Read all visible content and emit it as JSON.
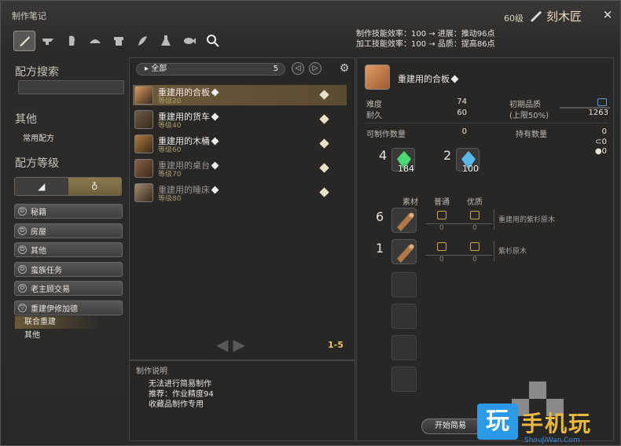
{
  "header": {
    "title": "制作笔记",
    "level": "60级",
    "job": "刻木匠",
    "close_glyph": "✕"
  },
  "tabs": [
    {
      "icon": "saw-icon",
      "active": true
    },
    {
      "icon": "anvil-icon",
      "active": false
    },
    {
      "icon": "gauntlet-icon",
      "active": false
    },
    {
      "icon": "helmet-icon",
      "active": false
    },
    {
      "icon": "armor-icon",
      "active": false
    },
    {
      "icon": "feather-icon",
      "active": false
    },
    {
      "icon": "flask-icon",
      "active": false
    },
    {
      "icon": "fish-icon",
      "active": false
    },
    {
      "icon": "search-icon",
      "active": false
    }
  ],
  "efficiency": {
    "line1": "制作技能效率：100 → 进展：推动96点",
    "line2": "加工技能效率：100 → 品质：提高86点"
  },
  "left": {
    "recipe_search": "配方搜索",
    "other_title": "其他",
    "common_recipes": "常用配方",
    "recipe_level": "配方等级",
    "categories": [
      {
        "label": "秘籍",
        "icon": "D"
      },
      {
        "label": "房屋",
        "icon": "D"
      },
      {
        "label": "其他",
        "icon": "D"
      },
      {
        "label": "蛮族任务",
        "icon": "D"
      },
      {
        "label": "老主顾交易",
        "icon": "D"
      },
      {
        "label": "重建伊修加德",
        "icon": "▽"
      }
    ],
    "subitems": [
      "联合重建",
      "其他"
    ]
  },
  "middle": {
    "filter": "全部",
    "count": "5",
    "prev_glyph": "◁",
    "next_glyph": "▷",
    "gear_glyph": "⚙",
    "recipes": [
      {
        "name": "重建用的合板",
        "level": "等级20",
        "color": "#d99a60",
        "selected": true,
        "dim": false
      },
      {
        "name": "重建用的货车",
        "level": "等级40",
        "color": "#6a5a48",
        "selected": false,
        "dim": false
      },
      {
        "name": "重建用的木桶",
        "level": "等级60",
        "color": "#b07a40",
        "selected": false,
        "dim": false
      },
      {
        "name": "重建用的桌台",
        "level": "等级70",
        "color": "#8a6048",
        "selected": false,
        "dim": true
      },
      {
        "name": "重建用的睡床",
        "level": "等级80",
        "color": "#a08a70",
        "selected": false,
        "dim": true
      }
    ],
    "pager": "1-5",
    "arrow_left": "◀",
    "arrow_right": "▶"
  },
  "description": {
    "title": "制作说明",
    "lines": [
      "无法进行简易制作",
      "推荐：作业精度94",
      "收藏品制作专用"
    ]
  },
  "detail": {
    "name": "重建用的合板",
    "difficulty_label": "难度",
    "difficulty": "74",
    "durability_label": "耐久",
    "durability": "60",
    "initial_quality_label": "初期品质",
    "initial_quality_note": "(上限50%)",
    "initial_quality": "1263",
    "craftable_label": "可制作数量",
    "craftable": "0",
    "owned_label": "持有数量",
    "owned": "0",
    "owned_nq": "0",
    "owned_hq": "0",
    "crystals": [
      {
        "need": "4",
        "have": "184",
        "color": "#4ad870"
      },
      {
        "need": "2",
        "have": "100",
        "color": "#5ab8e8"
      }
    ],
    "mat_header": "素材",
    "nq_header": "普通",
    "hq_header": "优质",
    "materials": [
      {
        "need": "6",
        "nq": "0",
        "hq": "0",
        "name": "重建用的紫杉原木"
      },
      {
        "need": "1",
        "nq": "0",
        "hq": "0",
        "name": "紫杉原木"
      }
    ],
    "start_button": "开始简易"
  },
  "watermark": {
    "logo": "玩",
    "text": "手机玩",
    "url": "ShouJiWan.Com"
  }
}
